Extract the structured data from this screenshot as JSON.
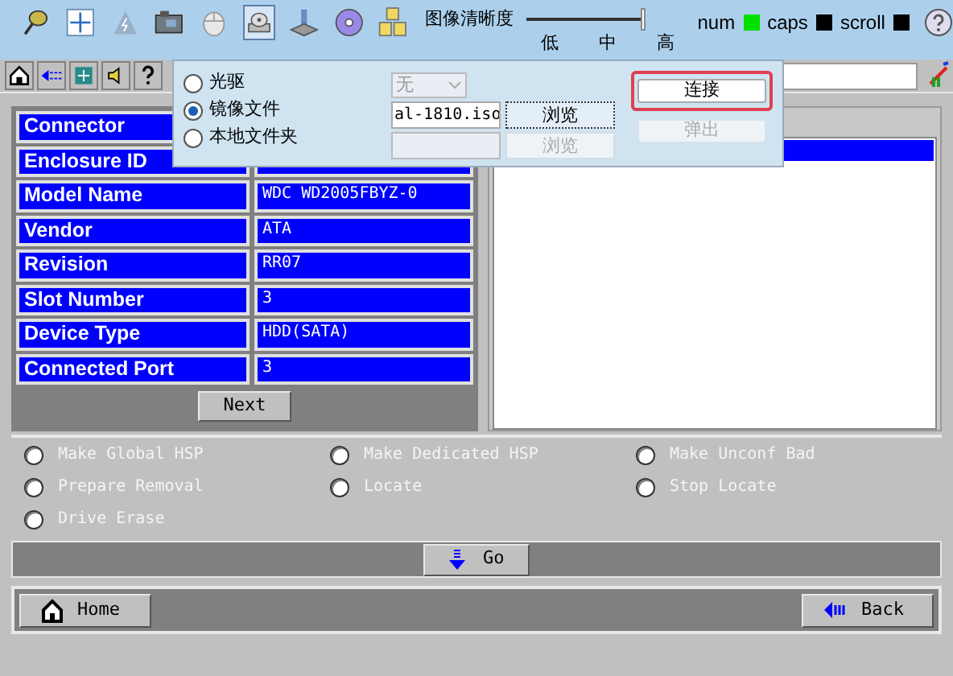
{
  "toolbar": {
    "quality": {
      "label": "图像清晰度",
      "level": 1,
      "marks": [
        "低",
        "中",
        "高"
      ]
    },
    "lights": [
      {
        "label": "num",
        "on": true
      },
      {
        "label": "caps",
        "on": false
      },
      {
        "label": "scroll",
        "on": false
      }
    ]
  },
  "media_popup": {
    "sources": [
      {
        "label": "光驱",
        "selected": false
      },
      {
        "label": "镜像文件",
        "selected": true
      },
      {
        "label": "本地文件夹",
        "selected": false
      }
    ],
    "drive_select": {
      "value": "无",
      "disabled": true
    },
    "image_file": {
      "value": "al-1810.iso"
    },
    "browse_buttons": [
      {
        "label": "浏览",
        "disabled": false
      },
      {
        "label": "浏览",
        "disabled": true
      }
    ],
    "actions": [
      {
        "label": "连接",
        "disabled": false,
        "highlighted": true
      },
      {
        "label": "弹出",
        "disabled": true,
        "highlighted": false
      }
    ]
  },
  "properties": [
    {
      "name": "Connector"
    },
    {
      "name": "Enclosure ID"
    },
    {
      "name": "Model Name",
      "value": "WDC WD2005FBYZ-0"
    },
    {
      "name": "Vendor",
      "value": "ATA"
    },
    {
      "name": "Revision",
      "value": "RR07"
    },
    {
      "name": "Slot Number",
      "value": "3"
    },
    {
      "name": "Device Type",
      "value": "HDD(SATA)"
    },
    {
      "name": "Connected Port",
      "value": "3"
    }
  ],
  "next_button": {
    "label": "Next"
  },
  "operations": [
    {
      "label": "Make Global HSP",
      "selected": false
    },
    {
      "label": "Make Dedicated HSP",
      "selected": false
    },
    {
      "label": "Make Unconf Bad",
      "selected": false
    },
    {
      "label": "Prepare Removal",
      "selected": false
    },
    {
      "label": "Locate",
      "selected": false
    },
    {
      "label": "Stop Locate",
      "selected": false
    },
    {
      "label": "Drive Erase",
      "selected": false
    }
  ],
  "go_button": {
    "label": "Go"
  },
  "nav": [
    {
      "kind": "home",
      "label": "Home"
    },
    {
      "kind": "back",
      "label": "Back"
    }
  ]
}
